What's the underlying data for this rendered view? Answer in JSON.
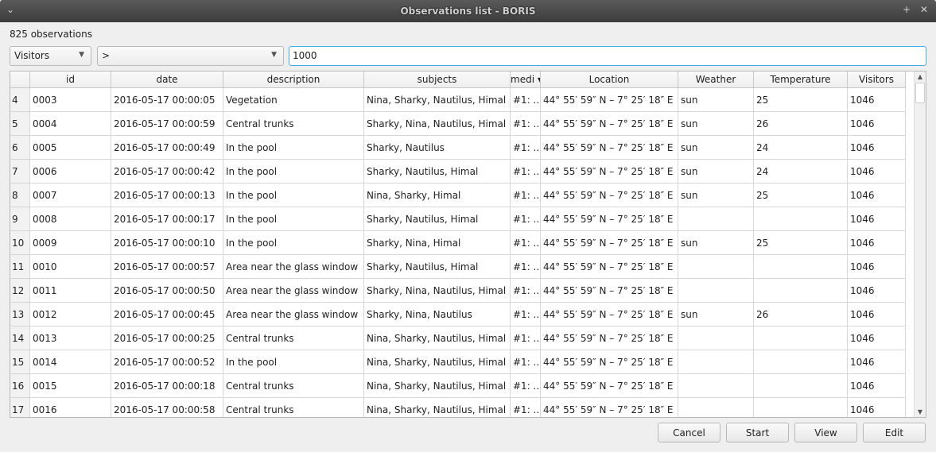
{
  "window": {
    "title": "Observations list - BORIS"
  },
  "count_label": "825 observations",
  "filter": {
    "field": "Visitors",
    "operator": ">",
    "value": "1000"
  },
  "columns": [
    "id",
    "date",
    "description",
    "subjects",
    "medi",
    "Location",
    "Weather",
    "Temperature",
    "Visitors"
  ],
  "sorted_column": "media",
  "rows": [
    {
      "n": "4",
      "id": "0003",
      "date": "2016-05-17 00:00:05",
      "description": "Vegetation",
      "subjects": "Nina, Sharky, Nautilus, Himal",
      "media": "#1: ...",
      "location": "44° 55′ 59″ N – 7° 25′ 18″ E",
      "weather": "sun",
      "temperature": "25",
      "visitors": "1046"
    },
    {
      "n": "5",
      "id": "0004",
      "date": "2016-05-17 00:00:59",
      "description": "Central trunks",
      "subjects": "Sharky, Nina, Nautilus, Himal",
      "media": "#1: ...",
      "location": "44° 55′ 59″ N – 7° 25′ 18″ E",
      "weather": "sun",
      "temperature": "26",
      "visitors": "1046"
    },
    {
      "n": "6",
      "id": "0005",
      "date": "2016-05-17 00:00:49",
      "description": "In the pool",
      "subjects": "Sharky, Nautilus",
      "media": "#1: ...",
      "location": "44° 55′ 59″ N – 7° 25′ 18″ E",
      "weather": "sun",
      "temperature": "24",
      "visitors": "1046"
    },
    {
      "n": "7",
      "id": "0006",
      "date": "2016-05-17 00:00:42",
      "description": "In the pool",
      "subjects": "Sharky, Nautilus, Himal",
      "media": "#1: ...",
      "location": "44° 55′ 59″ N – 7° 25′ 18″ E",
      "weather": "sun",
      "temperature": "24",
      "visitors": "1046"
    },
    {
      "n": "8",
      "id": "0007",
      "date": "2016-05-17 00:00:13",
      "description": "In the pool",
      "subjects": "Nina, Sharky, Himal",
      "media": "#1: ...",
      "location": "44° 55′ 59″ N – 7° 25′ 18″ E",
      "weather": "sun",
      "temperature": "25",
      "visitors": "1046"
    },
    {
      "n": "9",
      "id": "0008",
      "date": "2016-05-17 00:00:17",
      "description": "In the pool",
      "subjects": "Sharky, Nautilus, Himal",
      "media": "#1: ...",
      "location": "44° 55′ 59″ N – 7° 25′ 18″ E",
      "weather": "",
      "temperature": "",
      "visitors": "1046"
    },
    {
      "n": "10",
      "id": "0009",
      "date": "2016-05-17 00:00:10",
      "description": "In the pool",
      "subjects": "Sharky, Nina, Himal",
      "media": "#1: ...",
      "location": "44° 55′ 59″ N – 7° 25′ 18″ E",
      "weather": "sun",
      "temperature": "25",
      "visitors": "1046"
    },
    {
      "n": "11",
      "id": "0010",
      "date": "2016-05-17 00:00:57",
      "description": "Area near the glass window",
      "subjects": "Sharky, Nautilus, Himal",
      "media": "#1: ...",
      "location": "44° 55′ 59″ N – 7° 25′ 18″ E",
      "weather": "",
      "temperature": "",
      "visitors": "1046"
    },
    {
      "n": "12",
      "id": "0011",
      "date": "2016-05-17 00:00:50",
      "description": "Area near the glass window",
      "subjects": "Sharky, Nina, Nautilus, Himal",
      "media": "#1: ...",
      "location": "44° 55′ 59″ N – 7° 25′ 18″ E",
      "weather": "",
      "temperature": "",
      "visitors": "1046"
    },
    {
      "n": "13",
      "id": "0012",
      "date": "2016-05-17 00:00:45",
      "description": "Area near the glass window",
      "subjects": "Sharky, Nina, Nautilus",
      "media": "#1: ...",
      "location": "44° 55′ 59″ N – 7° 25′ 18″ E",
      "weather": "sun",
      "temperature": "26",
      "visitors": "1046"
    },
    {
      "n": "14",
      "id": "0013",
      "date": "2016-05-17 00:00:25",
      "description": "Central trunks",
      "subjects": "Nina, Sharky, Nautilus, Himal",
      "media": "#1: ...",
      "location": "44° 55′ 59″ N – 7° 25′ 18″ E",
      "weather": "",
      "temperature": "",
      "visitors": "1046"
    },
    {
      "n": "15",
      "id": "0014",
      "date": "2016-05-17 00:00:52",
      "description": "In the pool",
      "subjects": "Nina, Sharky, Nautilus, Himal",
      "media": "#1: ...",
      "location": "44° 55′ 59″ N – 7° 25′ 18″ E",
      "weather": "",
      "temperature": "",
      "visitors": "1046"
    },
    {
      "n": "16",
      "id": "0015",
      "date": "2016-05-17 00:00:18",
      "description": "Central trunks",
      "subjects": "Nina, Sharky, Nautilus, Himal",
      "media": "#1: ...",
      "location": "44° 55′ 59″ N – 7° 25′ 18″ E",
      "weather": "",
      "temperature": "",
      "visitors": "1046"
    },
    {
      "n": "17",
      "id": "0016",
      "date": "2016-05-17 00:00:58",
      "description": "Central trunks",
      "subjects": "Nina, Sharky, Nautilus, Himal",
      "media": "#1: ...",
      "location": "44° 55′ 59″ N – 7° 25′ 18″ E",
      "weather": "",
      "temperature": "",
      "visitors": "1046"
    }
  ],
  "buttons": {
    "cancel": "Cancel",
    "start": "Start",
    "view": "View",
    "edit": "Edit"
  }
}
